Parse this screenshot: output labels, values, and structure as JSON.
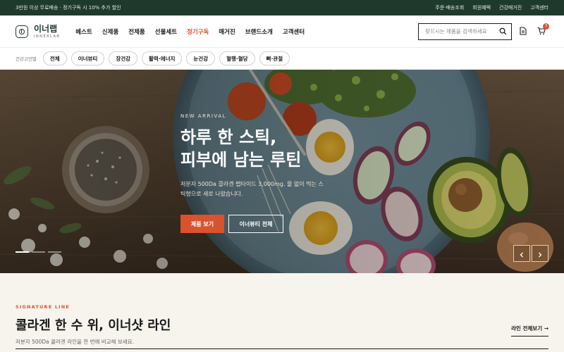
{
  "topbar": {
    "promo": "3만원 이상 무료배송 · 정기구독 시 10% 추가 할인",
    "links": [
      "주문·배송조회",
      "회원혜택",
      "건강매거진",
      "고객센터"
    ]
  },
  "header": {
    "logo_kr": "이너랩",
    "logo_en": "INNERLAB",
    "nav": [
      "베스트",
      "신제품",
      "전제품",
      "선물세트",
      "정기구독",
      "매거진",
      "브랜드소개",
      "고객센터"
    ],
    "active_nav": "정기구독",
    "search_placeholder": "찾으시는 제품을 검색하세요",
    "cart_count": "3"
  },
  "chips": {
    "label": "건강고민별",
    "items": [
      "전체",
      "이너뷰티",
      "장건강",
      "활력·에너지",
      "눈건강",
      "혈행·혈당",
      "뼈·관절"
    ]
  },
  "hero": {
    "kicker": "NEW ARRIVAL",
    "title_line1": "하루 한 스틱,",
    "title_line2": "피부에 남는 루틴",
    "desc": "저분자 500Da 콜라겐 펩타이드 3,000mg. 물 없이 먹는 스틱형으로 새로 나왔습니다.",
    "primary_btn": "제품 보기",
    "secondary_btn": "이너뷰티 전체",
    "slide_count": 3,
    "active_slide": 1
  },
  "signature": {
    "kicker": "SIGNATURE LINE",
    "title": "콜라겐 한 수 위, 이너샷 라인",
    "desc": "저분자 500Da 콜라겐 라인을 한 번에 비교해 보세요.",
    "more": "라인 전체보기 →"
  },
  "colors": {
    "brand_green": "#1f3a2c",
    "accent_orange": "#d8532d",
    "section_bg": "#f7f4ee"
  },
  "icons": [
    "search-icon",
    "document-icon",
    "cart-icon",
    "chevron-left-icon",
    "chevron-right-icon"
  ]
}
